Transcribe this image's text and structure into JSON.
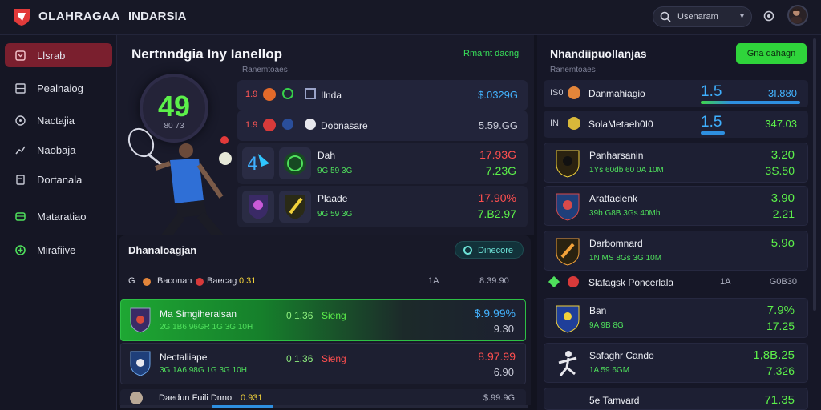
{
  "app": {
    "brand": "OLAHRAGAA",
    "section": "INDARSIA"
  },
  "search": {
    "placeholder": "Usenaram"
  },
  "sidebar": {
    "items": [
      {
        "label": "Llsrab",
        "icon": "bookmark-icon",
        "active": true
      },
      {
        "label": "Pealnaiog",
        "icon": "grid-icon",
        "active": false
      },
      {
        "label": "Nactajia",
        "icon": "compass-icon",
        "active": false
      },
      {
        "label": "Naobaja",
        "icon": "chart-icon",
        "active": false
      },
      {
        "label": "Dortanala",
        "icon": "document-icon",
        "active": false
      },
      {
        "label": "Mataratiao",
        "icon": "wallet-icon",
        "active": false
      },
      {
        "label": "Mirafiive",
        "icon": "plus-circle-icon",
        "active": false
      }
    ]
  },
  "hero": {
    "title": "Nertnndgia Iny Ianellop",
    "subhead": "Ranemtoaes",
    "live_label": "Rmarnt dacng",
    "score": "49",
    "score_sub": "80 73",
    "odds_rows": [
      {
        "a": "1.9",
        "b": "Ilnda",
        "value": "$.0329G"
      },
      {
        "a": "1.9",
        "b": "Dobnasare",
        "value": "5.59.GG"
      }
    ],
    "team_cards": [
      {
        "name": "Dah",
        "sub": "9G 59 3G",
        "r1": "17.93G",
        "r2": "7.23G"
      },
      {
        "name": "Plaade",
        "sub": "9G 59 3G",
        "r1": "17.90%",
        "r2": "7.B2.97"
      }
    ]
  },
  "list": {
    "title": "Dhanaloagjan",
    "discover": "Dinecore",
    "mini_row": {
      "a": "G",
      "b": "Baconan",
      "c": "Baecag",
      "d": "0.31",
      "e": "1A",
      "f": "8.39.90"
    },
    "items": [
      {
        "t1": "Ma Simgiheralsan",
        "t2": "2G 1B6 96GR 1G 3G 10H",
        "mid": "0 1.36",
        "mid2": "Sieng",
        "p1": "$.9.99%",
        "p2": "9.30",
        "highlight": true
      },
      {
        "t1": "Nectaliiape",
        "t2": "3G 1A6 98G 1G 3G 10H",
        "mid": "0 1.36",
        "mid2": "Sieng",
        "p1": "8.97.99",
        "p2": "6.90",
        "highlight": false
      }
    ],
    "last_row": {
      "a": "Daedun Fuili Dnno",
      "b": "0.931",
      "c": "$.99.9G"
    }
  },
  "right": {
    "title": "Nhandiipuollanjas",
    "subhead": "Ranemtoaes",
    "button": "Gna dahagn",
    "rows": [
      {
        "n": "IS0",
        "name": "Danmahiagio",
        "big": "1.5",
        "value": "3I.880"
      },
      {
        "n": "IN",
        "name": "SolaMetaeh0I0",
        "big": "1.5",
        "value": "347.03"
      }
    ],
    "cards": [
      {
        "name": "Panharsanin",
        "sub": "1Ys 60db 60 0A 10M",
        "c1": "3.20",
        "c2": "3S.50"
      },
      {
        "name": "Arattaclenk",
        "sub": "39b G8B 3Gs 40Mh",
        "c1": "3.90",
        "c2": "2.21"
      },
      {
        "name": "Darbomnard",
        "sub": "1N MS 8Gs 3G 10M",
        "c1": "5.9o",
        "c2": ""
      }
    ],
    "mini": {
      "name": "Slafagsk Poncerlala",
      "mid": "1A",
      "value": "G0B30"
    },
    "cards2": [
      {
        "name": "Ban",
        "sub": "9A 9B 8G",
        "c1": "7.9%",
        "c2": "17.25"
      },
      {
        "name": "Safaghr Cando",
        "sub": "1A 59 6GM",
        "c1": "1,8B.25",
        "c2": "7.326"
      },
      {
        "name": "5e Tamvard",
        "sub": "",
        "c1": "71.35",
        "c2": ""
      }
    ]
  },
  "colors": {
    "accent_green": "#5cf04a",
    "accent_red": "#ff4f4f",
    "accent_blue": "#43b3ff",
    "active_nav": "#7a1f2e"
  }
}
